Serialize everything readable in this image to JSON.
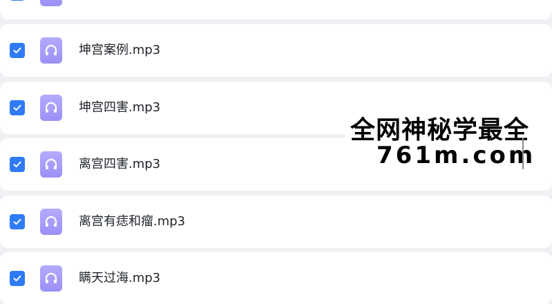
{
  "files": [
    {
      "name": "",
      "checked": true
    },
    {
      "name": "坤宫案例.mp3",
      "checked": true
    },
    {
      "name": "坤宫四害.mp3",
      "checked": true
    },
    {
      "name": "离宫四害.mp3",
      "checked": true
    },
    {
      "name": "离宫有痣和瘤.mp3",
      "checked": true
    },
    {
      "name": "瞒天过海.mp3",
      "checked": true
    }
  ],
  "icons": {
    "checkbox": "check-icon",
    "file": "headphones-icon"
  },
  "colors": {
    "checkbox": "#2f7bf5",
    "audio_icon": "#a89ff9",
    "row_background": "#ffffff",
    "page_background": "#eef0f4"
  },
  "watermark": {
    "line1": "全网神秘学最全",
    "line2": "761m.com"
  }
}
